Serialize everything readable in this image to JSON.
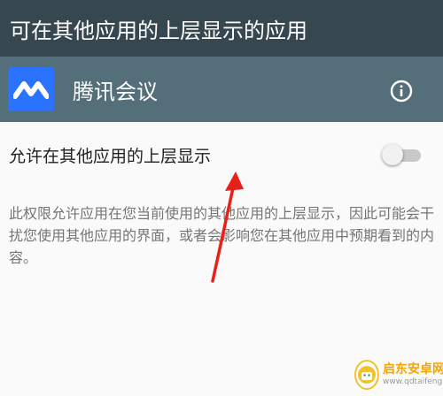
{
  "title_bar": {
    "title": "可在其他应用的上层显示的应用"
  },
  "app": {
    "name": "腾讯会议",
    "icon": "tencent-meeting-logo",
    "info_icon": "info-icon"
  },
  "permission": {
    "label": "允许在其他应用的上层显示",
    "enabled": false
  },
  "description": "此权限允许应用在您当前使用的其他应用的上层显示，因此可能会干扰您使用其他应用的界面，或者会影响您在其他应用中预期看到的内容。",
  "annotation": {
    "color": "#e8201a"
  },
  "watermark": {
    "name": "启东安卓网",
    "url": "www.qdtaifeng.com"
  },
  "colors": {
    "title_bar": "#37474f",
    "app_header": "#546e7a",
    "app_icon": "#2b73ff",
    "background": "#fafafa"
  }
}
